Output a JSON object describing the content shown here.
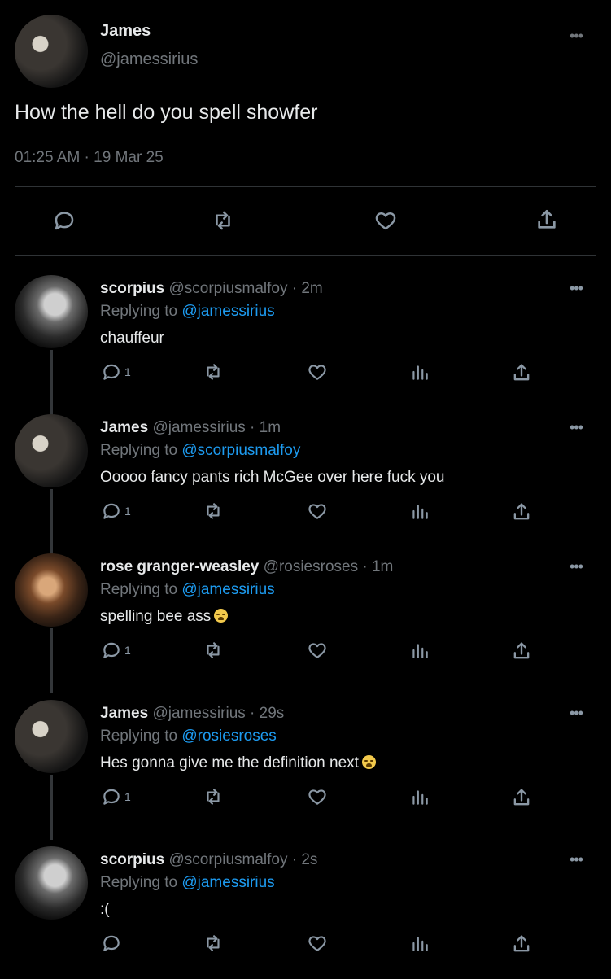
{
  "main_tweet": {
    "author_name": "James",
    "author_handle": "@jamessirius",
    "text": "How the hell do you spell showfer",
    "timestamp": "01:25 AM · 19 Mar 25",
    "more": "•••"
  },
  "replies": [
    {
      "name": "scorpius",
      "meta": "@scorpiusmalfoy · 2m",
      "replying_label": "Replying to",
      "replying_to": "@jamessirius",
      "text": "chauffeur",
      "reply_count": "1",
      "avatar": "scorpius",
      "emoji": false
    },
    {
      "name": "James",
      "meta": "@jamessirius · 1m",
      "replying_label": "Replying to",
      "replying_to": "@scorpiusmalfoy",
      "text": "Ooooo fancy pants rich McGee over here fuck you",
      "reply_count": "1",
      "avatar": "james",
      "emoji": false
    },
    {
      "name": "rose granger-weasley",
      "meta": "@rosiesroses · 1m",
      "replying_label": "Replying to",
      "replying_to": "@jamessirius",
      "text": "spelling bee ass",
      "reply_count": "1",
      "avatar": "rose",
      "emoji": true
    },
    {
      "name": "James",
      "meta": "@jamessirius · 29s",
      "replying_label": "Replying to",
      "replying_to": "@rosiesroses",
      "text": "Hes gonna give me the definition next",
      "reply_count": "1",
      "avatar": "james",
      "emoji": true
    },
    {
      "name": "scorpius",
      "meta": "@scorpiusmalfoy · 2s",
      "replying_label": "Replying to",
      "replying_to": "@jamessirius",
      "text": ":(",
      "reply_count": "",
      "avatar": "scorpius",
      "emoji": false
    }
  ],
  "icons": {
    "reply": "reply-icon",
    "retweet": "retweet-icon",
    "like": "like-icon",
    "views": "views-icon",
    "share": "share-icon",
    "more": "more-icon",
    "emoji": "loudly-crying-face-emoji"
  },
  "colors": {
    "background": "#000000",
    "text": "#e7e9ea",
    "muted": "#71767b",
    "link": "#1d9bf0",
    "divider": "#2f3336"
  }
}
